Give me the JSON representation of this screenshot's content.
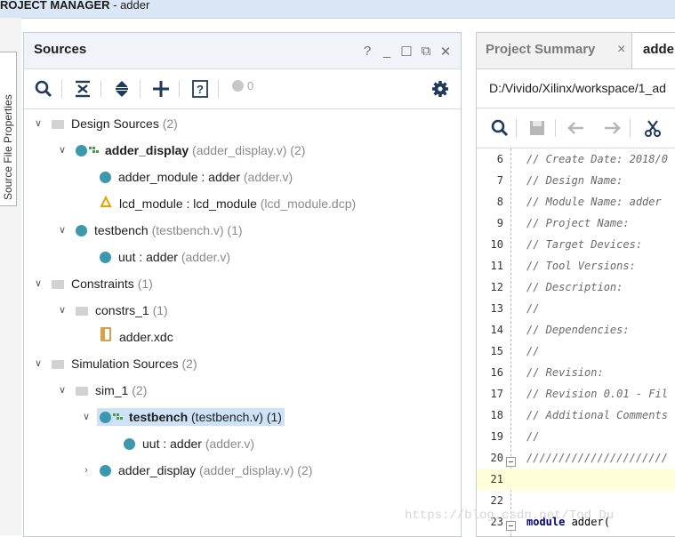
{
  "app": {
    "title_bold": "ROJECT MANAGER",
    "title_rest": " - adder"
  },
  "sidebar": {
    "vertical_tab": "Source File Properties"
  },
  "sources_panel": {
    "title": "Sources",
    "header_icons": [
      "help-icon",
      "minimize-icon",
      "maximize-icon",
      "float-icon",
      "close-icon"
    ],
    "header_glyphs": [
      "?",
      "_",
      "☐",
      "⧉",
      "✕"
    ],
    "toolbar_icons": [
      "search-icon",
      "collapse-all-icon",
      "expand-all-icon",
      "add-icon",
      "hierarchy-help-icon",
      "gear-icon"
    ],
    "error_count": "0",
    "tree": [
      {
        "depth": 0,
        "expanded": true,
        "icon": "folder",
        "name": "Design Sources",
        "detail": " (2)",
        "bold": false
      },
      {
        "depth": 1,
        "expanded": true,
        "icon": "module-top",
        "name": "adder_display",
        "detail": " (adder_display.v) (2)",
        "bold": true
      },
      {
        "depth": 2,
        "expanded": null,
        "icon": "module",
        "name": "adder_module : adder",
        "detail": " (adder.v)",
        "bold": false
      },
      {
        "depth": 2,
        "expanded": null,
        "icon": "dcp",
        "name": "lcd_module : lcd_module",
        "detail": " (lcd_module.dcp)",
        "bold": false
      },
      {
        "depth": 1,
        "expanded": true,
        "icon": "module",
        "name": "testbench",
        "detail": " (testbench.v) (1)",
        "bold": false
      },
      {
        "depth": 2,
        "expanded": null,
        "icon": "module",
        "name": "uut : adder",
        "detail": " (adder.v)",
        "bold": false
      },
      {
        "depth": 0,
        "expanded": true,
        "icon": "folder",
        "name": "Constraints",
        "detail": " (1)",
        "bold": false
      },
      {
        "depth": 1,
        "expanded": true,
        "icon": "folder",
        "name": "constrs_1",
        "detail": " (1)",
        "bold": false
      },
      {
        "depth": 2,
        "expanded": null,
        "icon": "xdc",
        "name": "adder.xdc",
        "detail": "",
        "bold": false
      },
      {
        "depth": 0,
        "expanded": true,
        "icon": "folder",
        "name": "Simulation Sources",
        "detail": " (2)",
        "bold": false
      },
      {
        "depth": 1,
        "expanded": true,
        "icon": "folder",
        "name": "sim_1",
        "detail": " (2)",
        "bold": false
      },
      {
        "depth": 2,
        "expanded": true,
        "icon": "module-top",
        "name": "testbench",
        "detail": " (testbench.v) (1)",
        "bold": true,
        "selected": true
      },
      {
        "depth": 3,
        "expanded": null,
        "icon": "module",
        "name": "uut : adder",
        "detail": " (adder.v)",
        "bold": false
      },
      {
        "depth": 2,
        "expanded": false,
        "icon": "module",
        "name": "adder_display",
        "detail": " (adder_display.v) (2)",
        "bold": false
      }
    ]
  },
  "editor": {
    "tab_project_summary": "Project Summary",
    "tab_close": "×",
    "tab_file": "adder",
    "path": "D:/Vivido/Xilinx/workspace/1_ad",
    "toolbar_icons": [
      "search-icon",
      "save-icon",
      "undo-icon",
      "redo-icon",
      "cut-icon"
    ],
    "lines": [
      {
        "no": "6",
        "text": "// Create Date: 2018/0",
        "kind": "comment"
      },
      {
        "no": "7",
        "text": "// Design Name:",
        "kind": "comment"
      },
      {
        "no": "8",
        "text": "// Module Name: adder",
        "kind": "comment"
      },
      {
        "no": "9",
        "text": "// Project Name:",
        "kind": "comment"
      },
      {
        "no": "10",
        "text": "// Target Devices:",
        "kind": "comment"
      },
      {
        "no": "11",
        "text": "// Tool Versions:",
        "kind": "comment"
      },
      {
        "no": "12",
        "text": "// Description:",
        "kind": "comment"
      },
      {
        "no": "13",
        "text": "//",
        "kind": "comment"
      },
      {
        "no": "14",
        "text": "// Dependencies:",
        "kind": "comment"
      },
      {
        "no": "15",
        "text": "//",
        "kind": "comment"
      },
      {
        "no": "16",
        "text": "// Revision:",
        "kind": "comment"
      },
      {
        "no": "17",
        "text": "// Revision 0.01 - Fil",
        "kind": "comment"
      },
      {
        "no": "18",
        "text": "// Additional Comments",
        "kind": "comment"
      },
      {
        "no": "19",
        "text": "//",
        "kind": "comment"
      },
      {
        "no": "20",
        "text": "//////////////////////",
        "kind": "comment",
        "fold": true
      },
      {
        "no": "21",
        "text": "",
        "kind": "blank",
        "highlight": true
      },
      {
        "no": "22",
        "text": "",
        "kind": "blank"
      },
      {
        "no": "23",
        "text": "module adder(",
        "kind": "code",
        "fold": true
      }
    ]
  },
  "watermark": "https://blog.csdn.net/Tod_Du",
  "colors": {
    "accent": "#3c98ac",
    "selection": "#cde2f6",
    "titlebar": "#dbe7f6",
    "current_line": "#fefed8"
  }
}
